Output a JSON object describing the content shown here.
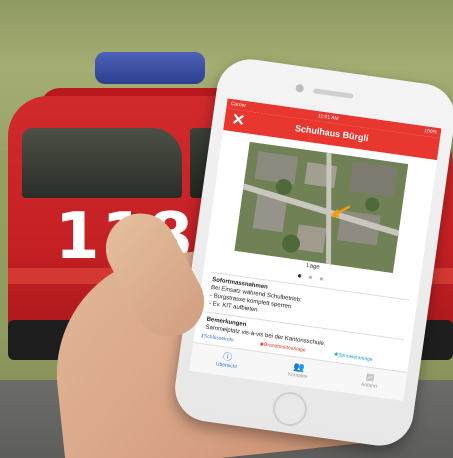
{
  "scene": {
    "car_number": "118"
  },
  "phone": {
    "status_bar": {
      "carrier": "Carrier",
      "time": "11:01 AM",
      "battery": "100%"
    },
    "nav": {
      "title": "Schulhaus Bürgli",
      "close_icon": "close-icon"
    },
    "image_caption": "Lage",
    "pager": {
      "dots": [
        "●",
        "●",
        "●"
      ],
      "active_index": 0
    },
    "sofortmassnahmen": {
      "heading": "Sofortmassnahmen",
      "intro": "Bei Einsatz während Schulbetrieb:",
      "items": [
        "- Burgstrasse komplett sperren",
        "- Ev. KIT aufbieten"
      ]
    },
    "bemerkungen": {
      "heading": "Bemerkungen",
      "text": "Sammelplatz vis-à-vis bei der Kantonsschule."
    },
    "legend": [
      {
        "icon": "key-icon",
        "label": "Schlüsselrohr",
        "color": "#2f7ad6"
      },
      {
        "icon": "fire-alarm-icon",
        "label": "Brandmeldeanlage",
        "color": "#e8372e"
      },
      {
        "icon": "sprinkler-icon",
        "label": "Sprinkleranlage",
        "color": "#1aa3d6"
      }
    ],
    "tabs": [
      {
        "label": "Übersicht",
        "icon": "info-icon",
        "active": true
      },
      {
        "label": "Kontakte",
        "icon": "contacts-icon",
        "active": false
      },
      {
        "label": "Anfahrt",
        "icon": "map-icon",
        "active": false
      }
    ]
  },
  "colors": {
    "accent_red": "#e8372e",
    "tab_active_blue": "#2f7ad6"
  }
}
